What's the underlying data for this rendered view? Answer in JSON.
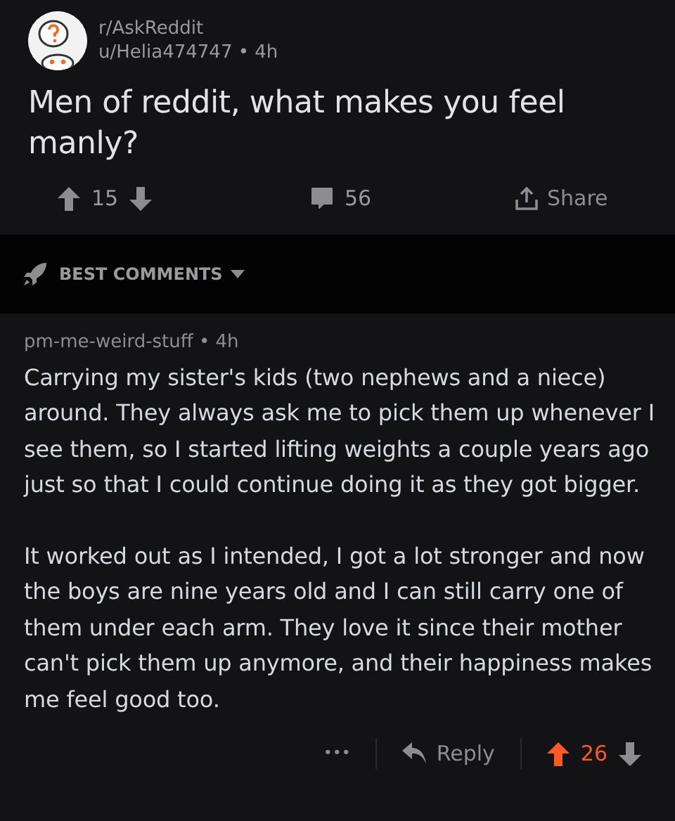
{
  "post": {
    "subreddit": "r/AskReddit",
    "author": "u/Helia474747",
    "separator": "•",
    "age": "4h",
    "title": "Men of reddit, what makes you feel manly?",
    "score": "15",
    "upvoted": false,
    "comments": "56",
    "share": "Share"
  },
  "sort": {
    "label": "BEST COMMENTS"
  },
  "comment": {
    "author": "pm-me-weird-stuff",
    "separator": "•",
    "age": "4h",
    "paragraphs": [
      "Carrying my sister's kids (two nephews and a niece) around. They always ask me to pick them up whenever I see them, so I started lifting weights a couple years ago just so that I could continue doing it as they got bigger.",
      "It worked out as I intended, I got a lot stronger and now the boys are nine years old and I can still carry one of them under each arm. They love it since their mother can't pick them up anymore, and their happiness makes me feel good too."
    ],
    "more": "•••",
    "reply": "Reply",
    "score": "26",
    "upvoted": true
  }
}
